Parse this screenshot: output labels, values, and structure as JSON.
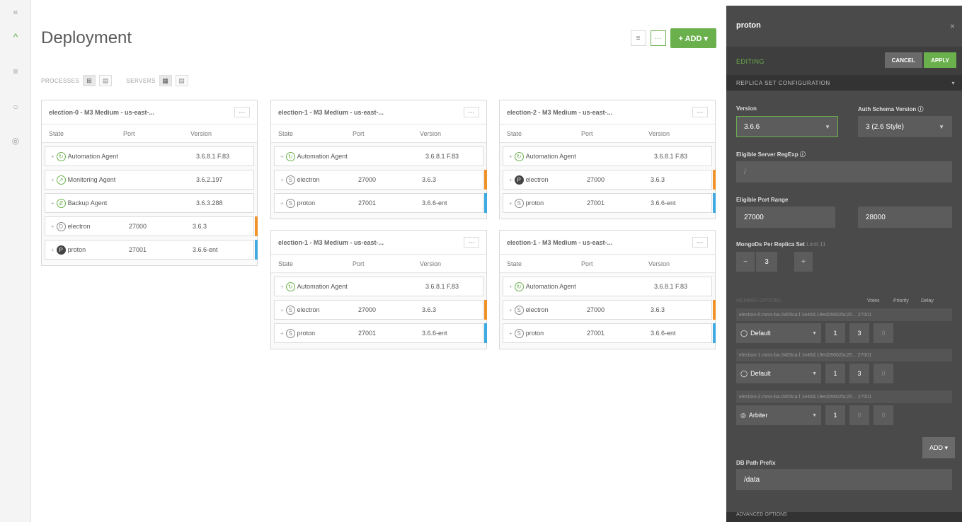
{
  "rail": {
    "items": [
      "«",
      "^",
      "≡",
      "○",
      "◎"
    ]
  },
  "main": {
    "title": "Deployment",
    "actions": {
      "view_icon": "≡",
      "more": "···",
      "add_label": "+ ADD ▾"
    },
    "toggles": [
      {
        "label": "PROCESSES",
        "opts": [
          "⊞",
          "▤"
        ]
      },
      {
        "label": "SERVERS",
        "opts": [
          "▦",
          "▤"
        ]
      }
    ],
    "columns": {
      "state": "State",
      "port": "Port",
      "version": "Version"
    },
    "cards": [
      {
        "title": "election-0 - M3 Medium - us-east-...",
        "more": "···",
        "rows": [
          {
            "icon": "↻",
            "name": "Automation Agent",
            "port": "",
            "version": "3.6.8.1 F.83"
          },
          {
            "icon": "↗",
            "name": "Monitoring Agent",
            "port": "",
            "version": "3.6.2.197"
          },
          {
            "icon": "⇵",
            "name": "Backup Agent",
            "port": "",
            "version": "3.6.3.288"
          },
          {
            "icon": "D",
            "name": "electron",
            "port": "27000",
            "version": "3.6.3"
          },
          {
            "icon": "P",
            "name": "proton",
            "port": "27001",
            "version": "3.6.6-ent"
          }
        ]
      },
      {
        "title": "election-1 - M3 Medium - us-east-...",
        "more": "···",
        "rows": [
          {
            "icon": "↻",
            "name": "Automation Agent",
            "port": "",
            "version": "3.6.8.1 F.83"
          },
          {
            "icon": "S",
            "name": "electron",
            "port": "27000",
            "version": "3.6.3"
          },
          {
            "icon": "S",
            "name": "proton",
            "port": "27001",
            "version": "3.6.6-ent"
          }
        ]
      },
      {
        "title": "election-2 - M3 Medium - us-east-...",
        "more": "···",
        "rows": [
          {
            "icon": "↻",
            "name": "Automation Agent",
            "port": "",
            "version": "3.6.8.1 F.83"
          },
          {
            "icon": "P",
            "name": "electron",
            "port": "27000",
            "version": "3.6.3"
          },
          {
            "icon": "S",
            "name": "proton",
            "port": "27001",
            "version": "3.6.6-ent"
          }
        ]
      },
      {
        "title": "election-1 - M3 Medium - us-east-...",
        "more": "···",
        "rows": [
          {
            "icon": "↻",
            "name": "Automation Agent",
            "port": "",
            "version": "3.6.8.1 F.83"
          },
          {
            "icon": "S",
            "name": "electron",
            "port": "27000",
            "version": "3.6.3"
          },
          {
            "icon": "S",
            "name": "proton",
            "port": "27001",
            "version": "3.6.6-ent"
          }
        ]
      },
      {
        "title": "election-1 - M3 Medium - us-east-...",
        "more": "···",
        "rows": [
          {
            "icon": "↻",
            "name": "Automation Agent",
            "port": "",
            "version": "3.6.8.1 F.83"
          },
          {
            "icon": "S",
            "name": "electron",
            "port": "27000",
            "version": "3.6.3"
          },
          {
            "icon": "S",
            "name": "proton",
            "port": "27001",
            "version": "3.6.6-ent"
          }
        ]
      }
    ]
  },
  "panel": {
    "title": "proton",
    "close": "×",
    "editing": "EDITING",
    "cancel": "CANCEL",
    "apply": "APPLY",
    "section": "REPLICA SET CONFIGURATION",
    "section_chevron": "▾",
    "version_label": "Version",
    "version_value": "3.6.6",
    "auth_label": "Auth Schema Version ⓘ",
    "auth_value": "3 (2.6 Style)",
    "eligible_regex_label": "Eligible Server RegExp ⓘ",
    "eligible_regex_value": "/",
    "port_range_label": "Eligible Port Range",
    "port_from": "27000",
    "port_to": "28000",
    "mongods_label": "MongoDs Per Replica Set",
    "mongods_limit": "Limit 11",
    "mongods_minus": "−",
    "mongods_value": "3",
    "mongods_plus": "+",
    "member_options": "MEMBER OPTIONS",
    "col_votes": "Votes",
    "col_priority": "Priority",
    "col_delay": "Delay",
    "members": [
      {
        "host": "election-0.mms-ba.0405ca.f.1e46d.19ed26602bc25...   27001",
        "type": "Default",
        "votes": "1",
        "priority": "3",
        "delay": "0"
      },
      {
        "host": "election-1.mms-ba.0405ca.f.1e46d.19ed26602bc25...   27001",
        "type": "Default",
        "votes": "1",
        "priority": "3",
        "delay": "0"
      },
      {
        "host": "election-2.mms-ba.0405ca.f.1e46d.19ed26602bc25...   27001",
        "type": "Arbiter",
        "votes": "1",
        "priority": "0",
        "delay": "0"
      }
    ],
    "add": "ADD ▾",
    "db_path_label": "DB Path Prefix",
    "db_path_value": "/data",
    "footer": "ADVANCED OPTIONS"
  }
}
